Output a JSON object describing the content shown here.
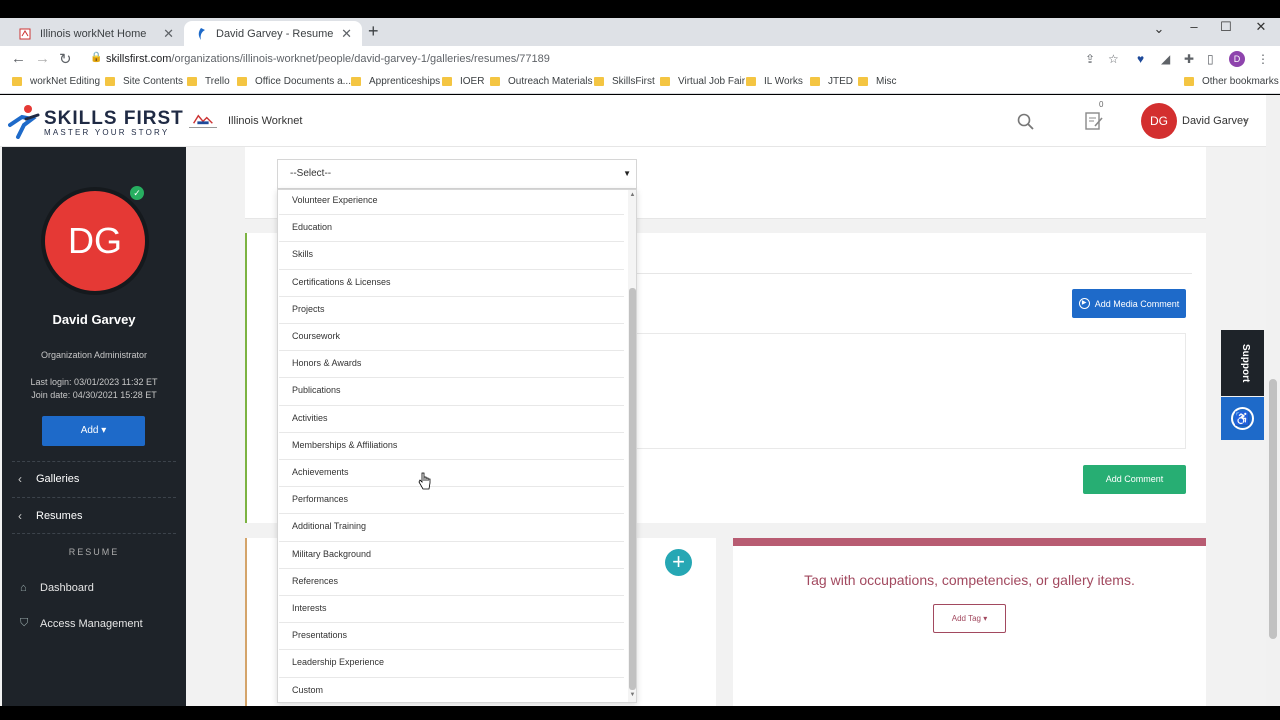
{
  "browser": {
    "tabs": [
      {
        "title": "Illinois workNet Home",
        "active": false
      },
      {
        "title": "David Garvey - Resume",
        "active": true
      }
    ],
    "url_host": "skillsfirst.com",
    "url_path": "/organizations/illinois-worknet/people/david-garvey-1/galleries/resumes/77189",
    "profile_initial": "D",
    "bookmarks": [
      "workNet Editing",
      "Site Contents",
      "Trello",
      "Office Documents a...",
      "Apprenticeships",
      "IOER",
      "Outreach Materials",
      "SkillsFirst",
      "Virtual Job Fair",
      "IL Works",
      "JTED",
      "Misc"
    ],
    "other_bookmarks": "Other bookmarks"
  },
  "header": {
    "logo_name": "SKILLS FIRST",
    "logo_tagline": "MASTER YOUR STORY",
    "org_name": "Illinois Worknet",
    "notes_count": "0",
    "avatar_initials": "DG",
    "user_name": "David Garvey"
  },
  "sidebar": {
    "avatar_initials": "DG",
    "name": "David Garvey",
    "role": "Organization Administrator",
    "last_login": "Last login: 03/01/2023 11:32 ET",
    "join_date": "Join date: 04/30/2021 15:28 ET",
    "add_label": "Add ▾",
    "nav": [
      "Galleries",
      "Resumes"
    ],
    "section_label": "RESUME",
    "links": [
      "Dashboard",
      "Access Management"
    ]
  },
  "select": {
    "placeholder": "--Select--",
    "options": [
      "Volunteer Experience",
      "Education",
      "Skills",
      "Certifications & Licenses",
      "Projects",
      "Coursework",
      "Honors & Awards",
      "Publications",
      "Activities",
      "Memberships & Affiliations",
      "Achievements",
      "Performances",
      "Additional Training",
      "Military Background",
      "References",
      "Interests",
      "Presentations",
      "Leadership Experience",
      "Custom"
    ]
  },
  "main": {
    "add_media_comment": "Add Media Comment",
    "add_comment": "Add Comment",
    "tag_title": "Tag with occupations, competencies, or gallery items.",
    "add_tag": "Add Tag ▾"
  },
  "widgets": {
    "support": "Support"
  }
}
